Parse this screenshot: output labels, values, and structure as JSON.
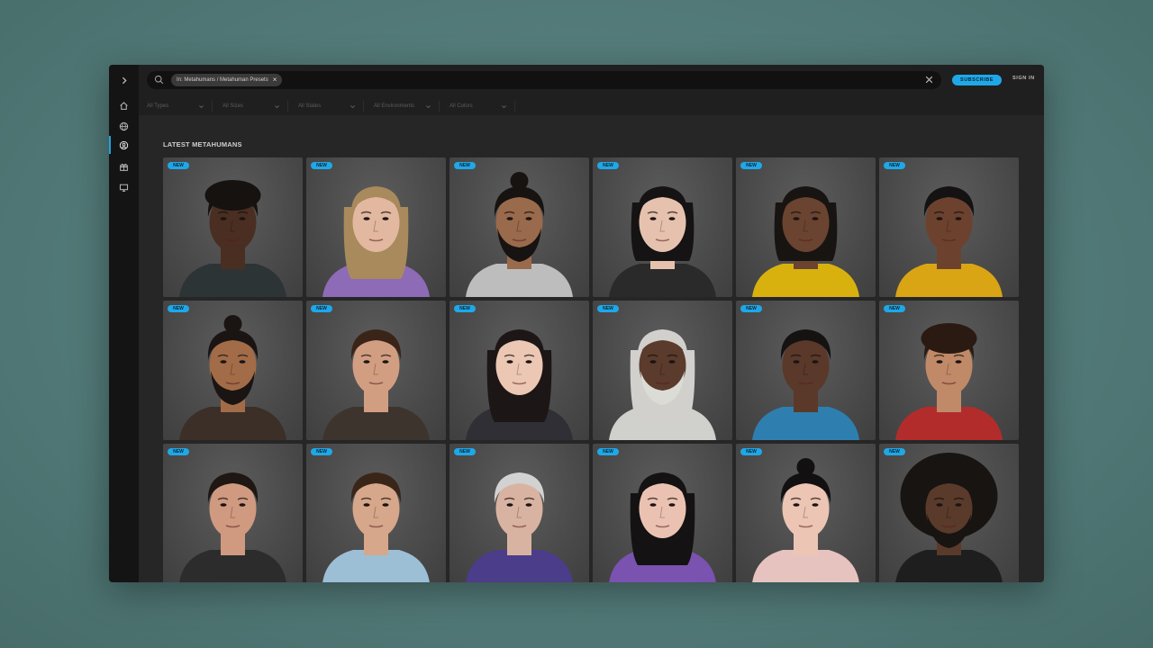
{
  "search": {
    "filter_chip": "In: Metahumans / Metahuman Presets",
    "chip_close": "×"
  },
  "header": {
    "subscribe_label": "SUBSCRIBE",
    "signin_label": "SIGN IN"
  },
  "filters": [
    "All Types",
    "All Sizes",
    "All States",
    "All Environments",
    "All Colors"
  ],
  "section_title": "LATEST METAHUMANS",
  "badge_label": "NEW",
  "cards": [
    {
      "skin": "#4a2e22",
      "hair": "#161210",
      "shirt": "#2d3436",
      "hairstyle": "curly"
    },
    {
      "skin": "#e3b8a0",
      "hair": "#a98a5c",
      "shirt": "#8e6bb6",
      "hairstyle": "long"
    },
    {
      "skin": "#9a6a4c",
      "hair": "#161311",
      "shirt": "#bdbdbd",
      "hairstyle": "bun",
      "beard": true
    },
    {
      "skin": "#e6c2ae",
      "hair": "#151313",
      "shirt": "#2a2a2a",
      "hairstyle": "bob"
    },
    {
      "skin": "#6a4430",
      "hair": "#171412",
      "shirt": "#d8b10f",
      "hairstyle": "bob"
    },
    {
      "skin": "#6c422e",
      "hair": "#141212",
      "shirt": "#d9a514",
      "hairstyle": "short"
    },
    {
      "skin": "#a26c48",
      "hair": "#1a1512",
      "shirt": "#3b2f28",
      "hairstyle": "bun",
      "beard": true
    },
    {
      "skin": "#d29e82",
      "hair": "#3a2418",
      "shirt": "#3e342e",
      "hairstyle": "short"
    },
    {
      "skin": "#ebc7b4",
      "hair": "#1d1616",
      "shirt": "#2f2f35",
      "hairstyle": "long"
    },
    {
      "skin": "#5a3b2c",
      "hair": "#d1d0cc",
      "shirt": "#d0d0cc",
      "hairstyle": "long",
      "beard": true,
      "beard_color": "#dcdcd6"
    },
    {
      "skin": "#5a382a",
      "hair": "#151212",
      "shirt": "#2e7fb0",
      "hairstyle": "short"
    },
    {
      "skin": "#c08a68",
      "hair": "#2b1a12",
      "shirt": "#b22c2c",
      "hairstyle": "curly"
    },
    {
      "skin": "#cf9a80",
      "hair": "#1e1713",
      "shirt": "#2c2c2c",
      "hairstyle": "short"
    },
    {
      "skin": "#d6a78a",
      "hair": "#3a2619",
      "shirt": "#9cbfd6",
      "hairstyle": "short"
    },
    {
      "skin": "#d9b3a2",
      "hair": "#d2d2d2",
      "shirt": "#4b3d8a",
      "hairstyle": "short"
    },
    {
      "skin": "#ebc2b2",
      "hair": "#141212",
      "shirt": "#7a52b0",
      "hairstyle": "long"
    },
    {
      "skin": "#ecc5b4",
      "hair": "#121010",
      "shirt": "#e7c3c0",
      "hairstyle": "bun"
    },
    {
      "skin": "#5a3a2a",
      "hair": "#181412",
      "shirt": "#1e1e1e",
      "hairstyle": "afro",
      "beard": true
    }
  ]
}
